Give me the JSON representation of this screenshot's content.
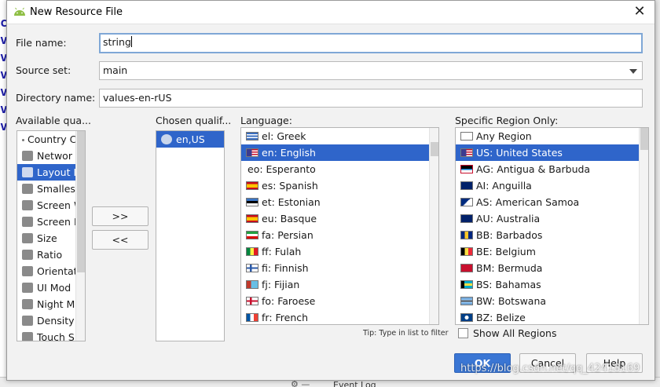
{
  "dialog": {
    "title": "New Resource File",
    "close_label": "✕",
    "file_name": {
      "label": "File name:",
      "value": "string"
    },
    "source_set": {
      "label": "Source set:",
      "value": "main"
    },
    "directory_name": {
      "label": "Directory name:",
      "value": "values-en-rUS"
    }
  },
  "available": {
    "header": "Available qua...",
    "items": [
      {
        "label": "Country Co",
        "icon": "dot-icon"
      },
      {
        "label": "Networ",
        "icon": "network-icon"
      },
      {
        "label": "Layout D",
        "icon": "layout-direction-icon",
        "selected": true
      },
      {
        "label": "Smallest",
        "icon": "smallest-width-icon"
      },
      {
        "label": "Screen W",
        "icon": "screen-width-icon"
      },
      {
        "label": "Screen H",
        "icon": "screen-height-icon"
      },
      {
        "label": "Size",
        "icon": "size-icon"
      },
      {
        "label": "Ratio",
        "icon": "ratio-icon"
      },
      {
        "label": "Orientat",
        "icon": "orientation-icon"
      },
      {
        "label": "UI Mod",
        "icon": "ui-mode-icon"
      },
      {
        "label": "Night M",
        "icon": "night-mode-icon"
      },
      {
        "label": "Density",
        "icon": "density-icon"
      },
      {
        "label": "Touch S",
        "icon": "touch-screen-icon"
      }
    ]
  },
  "arrows": {
    "add": ">>",
    "remove": "<<"
  },
  "chosen": {
    "header": "Chosen qualif...",
    "items": [
      {
        "label": "en,US",
        "icon": "globe-icon",
        "selected": true
      }
    ]
  },
  "language": {
    "header": "Language:",
    "items": [
      {
        "label": "el: Greek",
        "flag": "gr"
      },
      {
        "label": "en: English",
        "flag": "us",
        "selected": true
      },
      {
        "label": "eo: Esperanto",
        "flag": ""
      },
      {
        "label": "es: Spanish",
        "flag": "es"
      },
      {
        "label": "et: Estonian",
        "flag": "ee"
      },
      {
        "label": "eu: Basque",
        "flag": "es"
      },
      {
        "label": "fa: Persian",
        "flag": "ir"
      },
      {
        "label": "ff: Fulah",
        "flag": "sn"
      },
      {
        "label": "fi: Finnish",
        "flag": "fi"
      },
      {
        "label": "fj: Fijian",
        "flag": "fj"
      },
      {
        "label": "fo: Faroese",
        "flag": "fo"
      },
      {
        "label": "fr: French",
        "flag": "fr"
      }
    ],
    "hint": "Tip: Type in list to filter"
  },
  "region": {
    "header": "Specific Region Only:",
    "items": [
      {
        "label": "Any Region",
        "flag": "none"
      },
      {
        "label": "US: United States",
        "flag": "us",
        "selected": true
      },
      {
        "label": "AG: Antigua & Barbuda",
        "flag": "ag"
      },
      {
        "label": "AI: Anguilla",
        "flag": "ai"
      },
      {
        "label": "AS: American Samoa",
        "flag": "as"
      },
      {
        "label": "AU: Australia",
        "flag": "au"
      },
      {
        "label": "BB: Barbados",
        "flag": "bb"
      },
      {
        "label": "BE: Belgium",
        "flag": "be"
      },
      {
        "label": "BM: Bermuda",
        "flag": "bm"
      },
      {
        "label": "BS: Bahamas",
        "flag": "bs"
      },
      {
        "label": "BW: Botswana",
        "flag": "bw"
      },
      {
        "label": "BZ: Belize",
        "flag": "bz"
      }
    ],
    "show_all_label": "Show All Regions"
  },
  "buttons": {
    "ok": "OK",
    "cancel": "Cancel",
    "help": "Help"
  },
  "ide": {
    "event_log": "Event Log"
  },
  "watermark": "https://blog.csdn.net/qq_42418169"
}
